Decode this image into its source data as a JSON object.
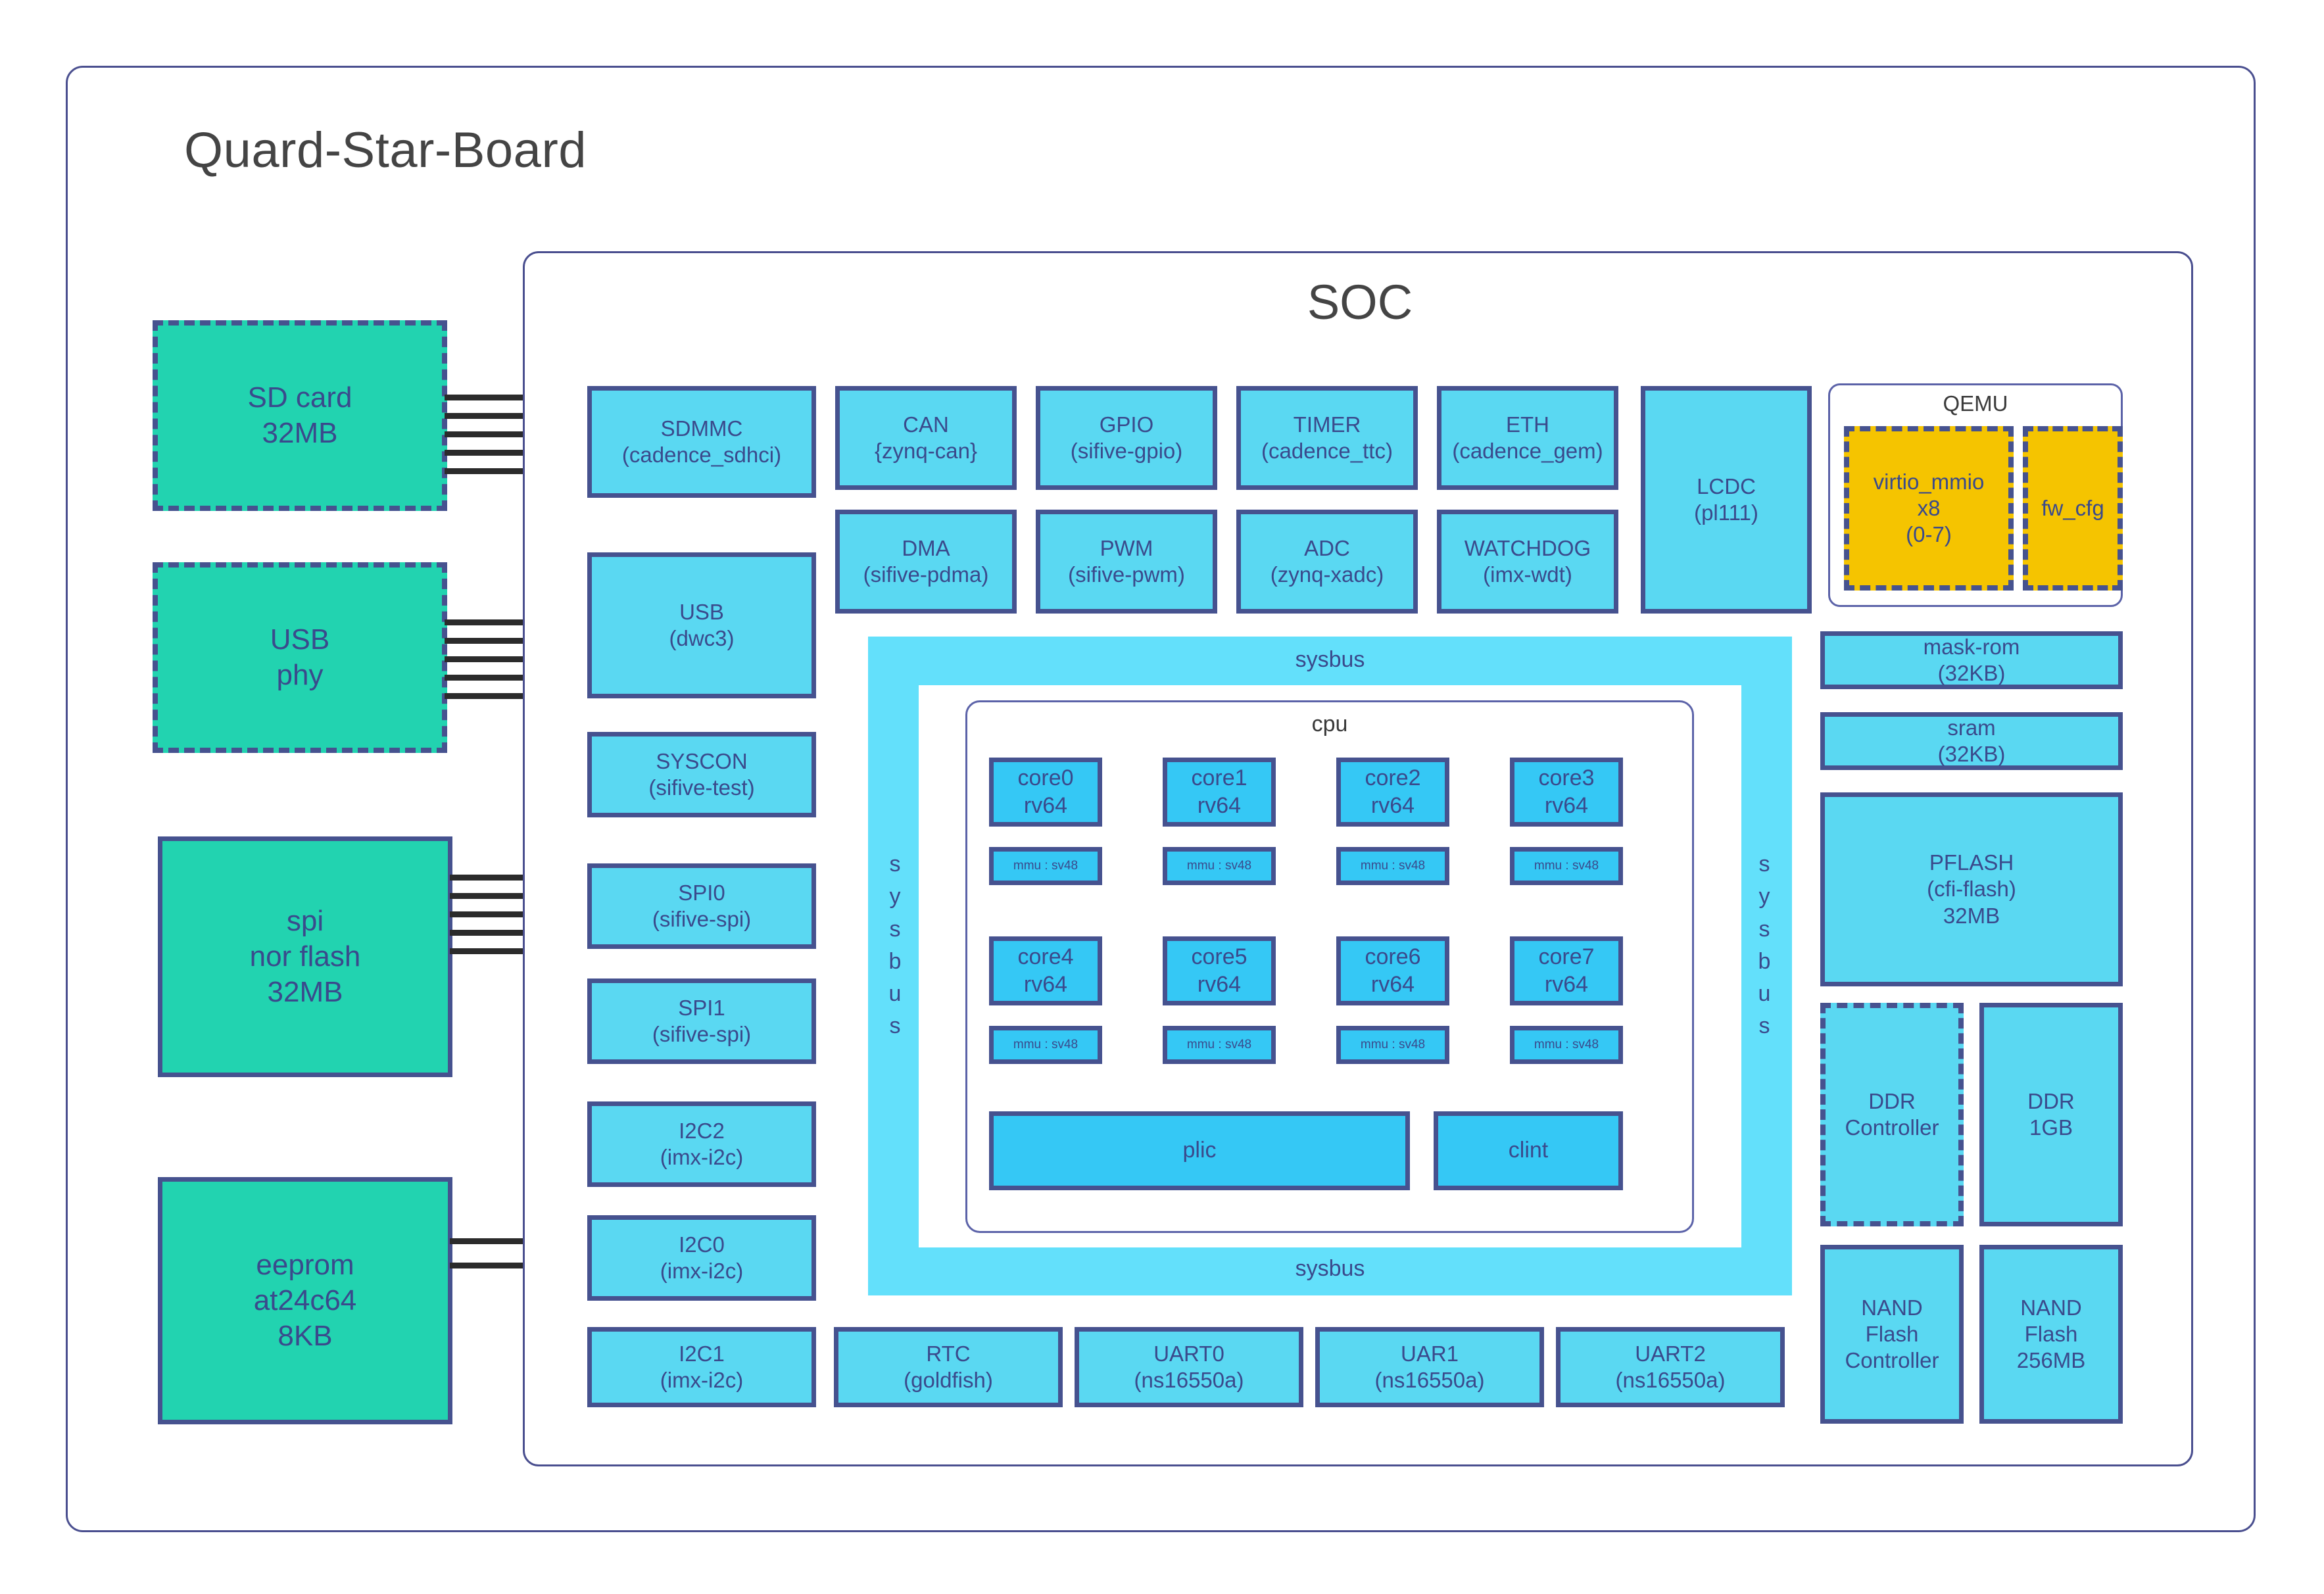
{
  "board": {
    "title": "Quard-Star-Board"
  },
  "soc": {
    "title": "SOC"
  },
  "external": [
    {
      "name": "sd-card",
      "line1": "SD card",
      "line2": "32MB",
      "line3": ""
    },
    {
      "name": "usb-phy",
      "line1": "USB",
      "line2": "phy",
      "line3": ""
    },
    {
      "name": "spi-nor-flash",
      "line1": "spi",
      "line2": "nor flash",
      "line3": "32MB"
    },
    {
      "name": "eeprom",
      "line1": "eeprom",
      "line2": "at24c64",
      "line3": "8KB"
    }
  ],
  "left_peripherals": [
    {
      "name": "sdmmc",
      "line1": "SDMMC",
      "line2": "(cadence_sdhci)"
    },
    {
      "name": "usb",
      "line1": "USB",
      "line2": "(dwc3)"
    },
    {
      "name": "syscon",
      "line1": "SYSCON",
      "line2": "(sifive-test)"
    },
    {
      "name": "spi0",
      "line1": "SPI0",
      "line2": "(sifive-spi)"
    },
    {
      "name": "spi1",
      "line1": "SPI1",
      "line2": "(sifive-spi)"
    },
    {
      "name": "i2c2",
      "line1": "I2C2",
      "line2": "(imx-i2c)"
    },
    {
      "name": "i2c0",
      "line1": "I2C0",
      "line2": "(imx-i2c)"
    }
  ],
  "top_peripherals_row1": [
    {
      "name": "can",
      "line1": "CAN",
      "line2": "{zynq-can}"
    },
    {
      "name": "gpio",
      "line1": "GPIO",
      "line2": "(sifive-gpio)"
    },
    {
      "name": "timer",
      "line1": "TIMER",
      "line2": "(cadence_ttc)"
    },
    {
      "name": "eth",
      "line1": "ETH",
      "line2": "(cadence_gem)"
    }
  ],
  "top_peripherals_row2": [
    {
      "name": "dma",
      "line1": "DMA",
      "line2": "(sifive-pdma)"
    },
    {
      "name": "pwm",
      "line1": "PWM",
      "line2": "(sifive-pwm)"
    },
    {
      "name": "adc",
      "line1": "ADC",
      "line2": "(zynq-xadc)"
    },
    {
      "name": "watchdog",
      "line1": "WATCHDOG",
      "line2": "(imx-wdt)"
    }
  ],
  "lcdc": {
    "line1": "LCDC",
    "line2": "(pl111)"
  },
  "qemu": {
    "title": "QEMU",
    "devices": [
      {
        "name": "virtio-mmio",
        "line1": "virtio_mmio",
        "line2": "x8",
        "line3": "(0-7)"
      },
      {
        "name": "fw-cfg",
        "line1": "fw_cfg",
        "line2": "",
        "line3": ""
      }
    ]
  },
  "memories": [
    {
      "name": "mask-rom",
      "line1": "mask-rom",
      "line2": "(32KB)",
      "line3": ""
    },
    {
      "name": "sram",
      "line1": "sram",
      "line2": "(32KB)",
      "line3": ""
    },
    {
      "name": "pflash",
      "line1": "PFLASH",
      "line2": "(cfi-flash)",
      "line3": "32MB"
    },
    {
      "name": "ddr-controller",
      "line1": "DDR",
      "line2": "Controller",
      "line3": ""
    },
    {
      "name": "ddr",
      "line1": "DDR",
      "line2": "1GB",
      "line3": ""
    },
    {
      "name": "nand-flash-controller",
      "line1": "NAND",
      "line2": "Flash",
      "line3": "Controller"
    },
    {
      "name": "nand-flash",
      "line1": "NAND",
      "line2": "Flash",
      "line3": "256MB"
    }
  ],
  "bottom_peripherals": [
    {
      "name": "i2c1",
      "line1": "I2C1",
      "line2": "(imx-i2c)"
    },
    {
      "name": "rtc",
      "line1": "RTC",
      "line2": "(goldfish)"
    },
    {
      "name": "uart0",
      "line1": "UART0",
      "line2": "(ns16550a)"
    },
    {
      "name": "uart1",
      "line1": "UAR1",
      "line2": "(ns16550a)"
    },
    {
      "name": "uart2",
      "line1": "UART2",
      "line2": "(ns16550a)"
    }
  ],
  "sysbus": {
    "top_label": "sysbus",
    "bottom_label": "sysbus",
    "left_letters": [
      "s",
      "y",
      "s",
      "b",
      "u",
      "s"
    ],
    "right_letters": [
      "s",
      "y",
      "s",
      "b",
      "u",
      "s"
    ]
  },
  "cpu": {
    "title": "cpu",
    "cores": [
      {
        "name": "core0",
        "line1": "core0",
        "line2": "rv64",
        "mmu": "mmu : sv48"
      },
      {
        "name": "core1",
        "line1": "core1",
        "line2": "rv64",
        "mmu": "mmu : sv48"
      },
      {
        "name": "core2",
        "line1": "core2",
        "line2": "rv64",
        "mmu": "mmu : sv48"
      },
      {
        "name": "core3",
        "line1": "core3",
        "line2": "rv64",
        "mmu": "mmu : sv48"
      },
      {
        "name": "core4",
        "line1": "core4",
        "line2": "rv64",
        "mmu": "mmu : sv48"
      },
      {
        "name": "core5",
        "line1": "core5",
        "line2": "rv64",
        "mmu": "mmu : sv48"
      },
      {
        "name": "core6",
        "line1": "core6",
        "line2": "rv64",
        "mmu": "mmu : sv48"
      },
      {
        "name": "core7",
        "line1": "core7",
        "line2": "rv64",
        "mmu": "mmu : sv48"
      }
    ],
    "interrupt_blocks": [
      {
        "name": "plic",
        "label": "plic"
      },
      {
        "name": "clint",
        "label": "clint"
      }
    ]
  },
  "colors": {
    "block_fill": "#5ad8f2",
    "block_border": "#46528f",
    "external_fill": "#22d3b0",
    "qemu_device_fill": "#f5c400",
    "sysbus_fill": "#63e0fb",
    "core_fill": "#35c8f5",
    "text": "#3a4a8c",
    "frame": "#4a4f8f"
  }
}
